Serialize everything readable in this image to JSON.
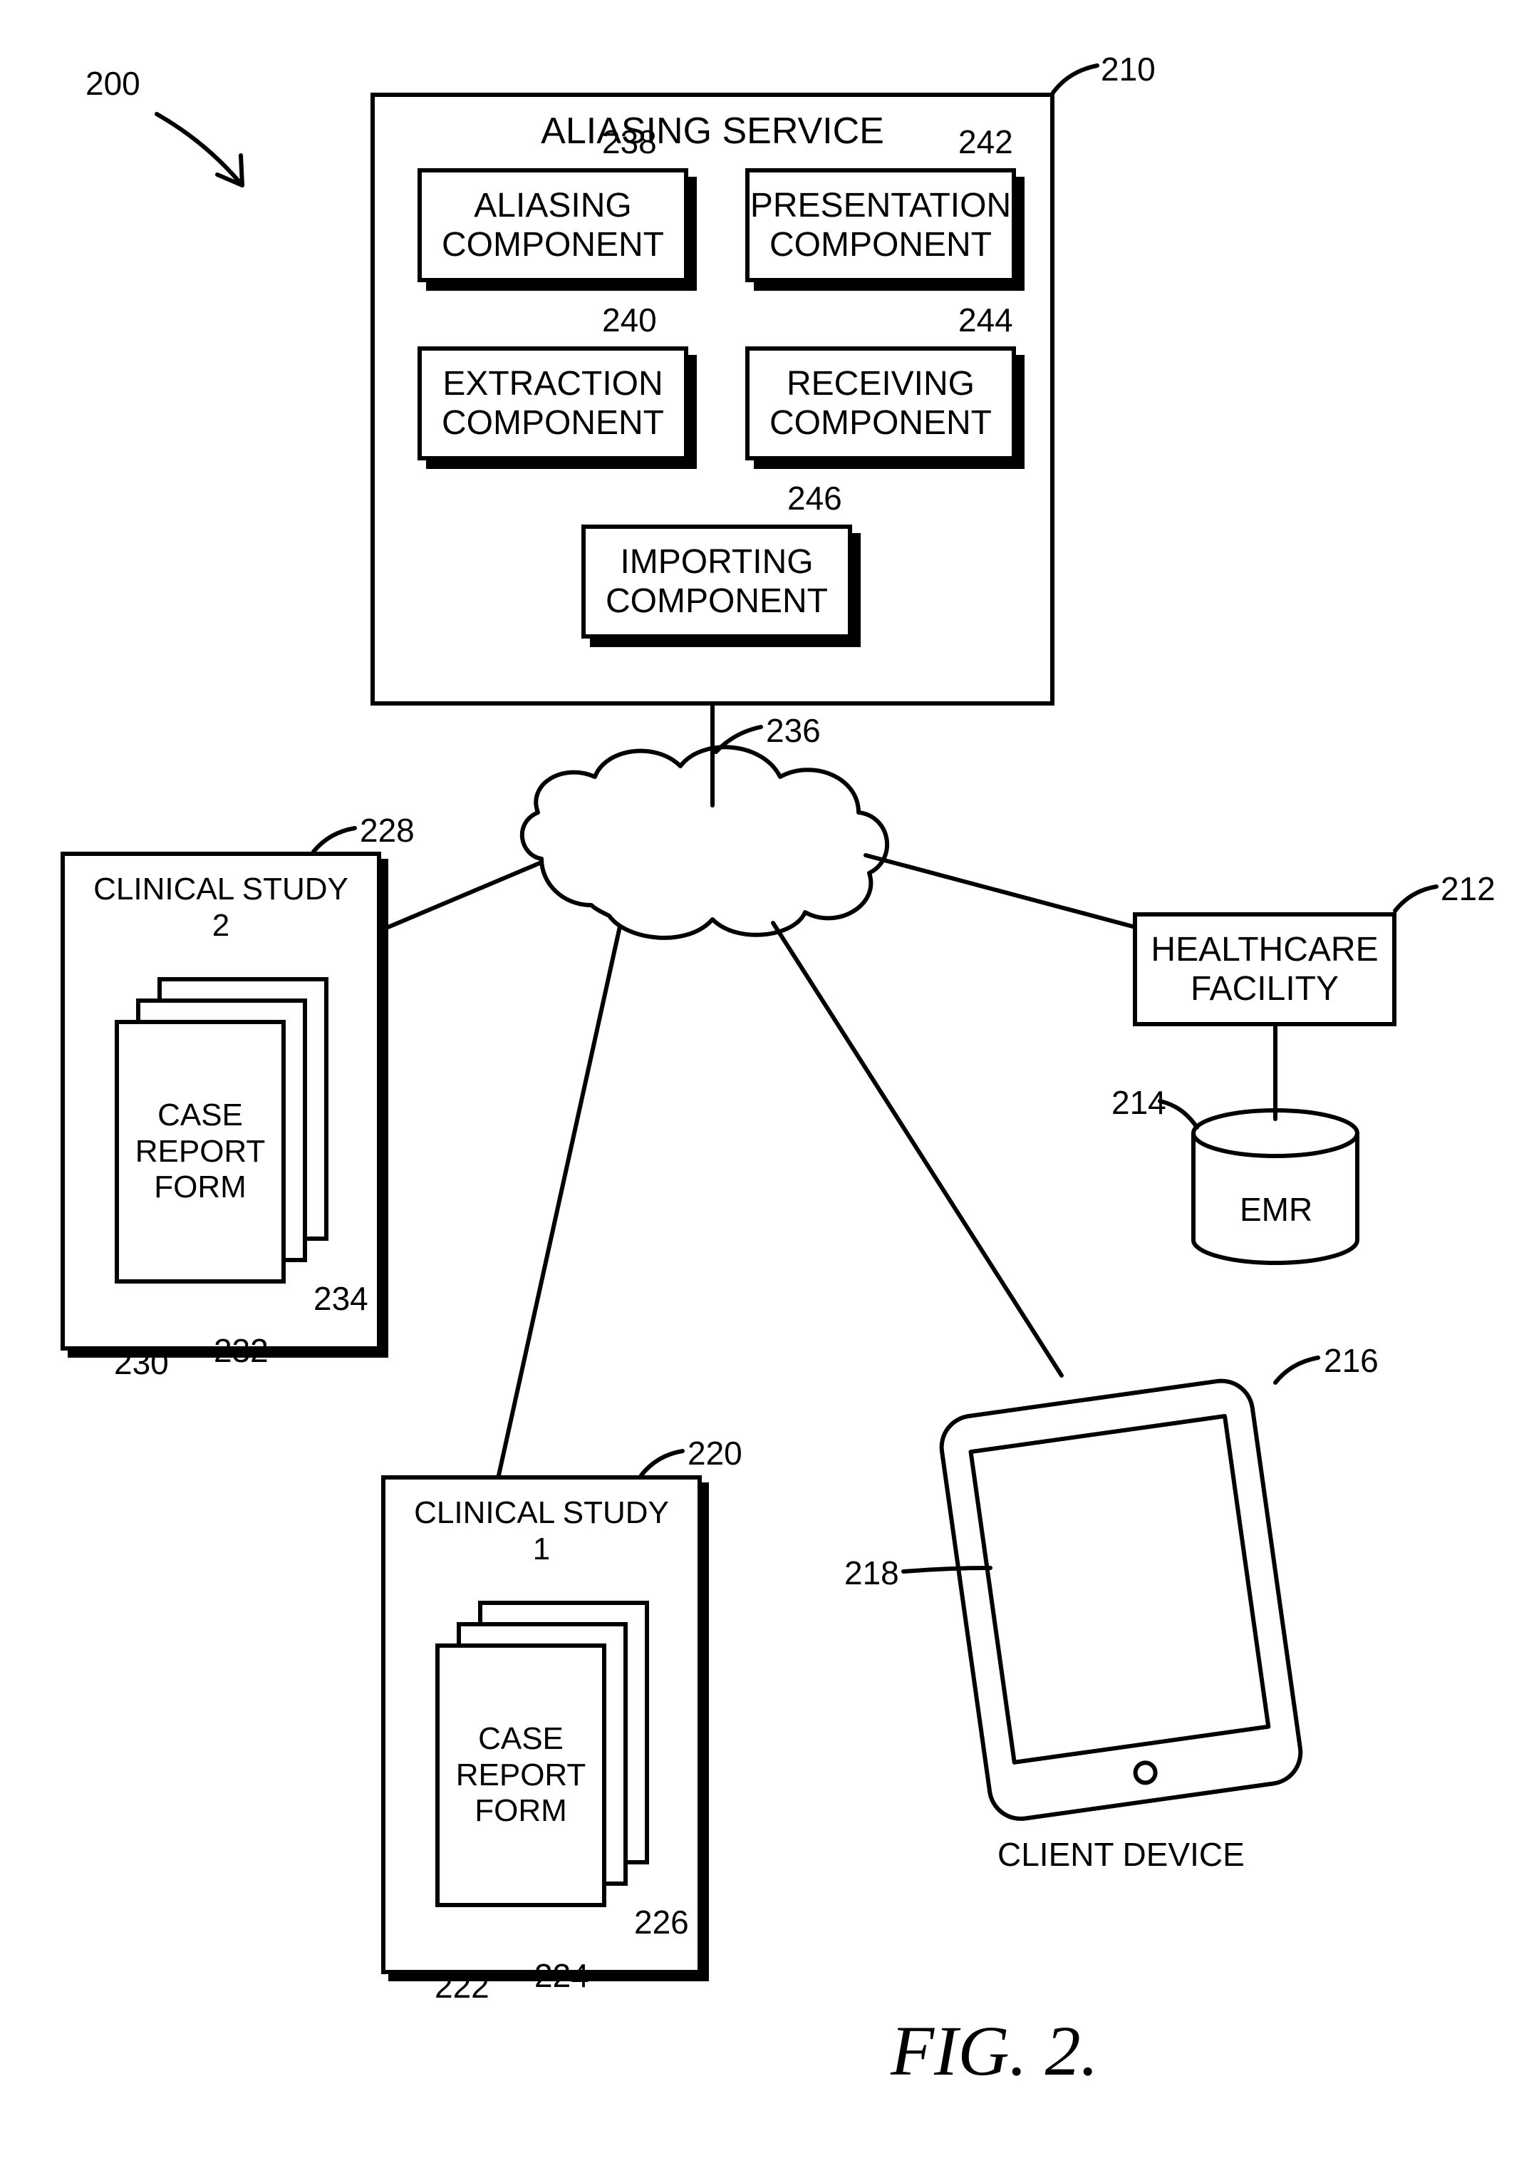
{
  "figure": {
    "number_ref": "200",
    "caption": "FIG. 2."
  },
  "aliasing_service": {
    "ref": "210",
    "title": "ALIASING SERVICE",
    "components": {
      "aliasing": {
        "ref": "238",
        "label": "ALIASING\nCOMPONENT"
      },
      "presentation": {
        "ref": "242",
        "label": "PRESENTATION\nCOMPONENT"
      },
      "extraction": {
        "ref": "240",
        "label": "EXTRACTION\nCOMPONENT"
      },
      "receiving": {
        "ref": "244",
        "label": "RECEIVING\nCOMPONENT"
      },
      "importing": {
        "ref": "246",
        "label": "IMPORTING\nCOMPONENT"
      }
    }
  },
  "cloud": {
    "ref": "236"
  },
  "clinical_study_2": {
    "ref": "228",
    "title": "CLINICAL STUDY\n2",
    "crf_label": "CASE\nREPORT\nFORM",
    "crf_refs": {
      "front": "230",
      "mid": "232",
      "back": "234"
    }
  },
  "clinical_study_1": {
    "ref": "220",
    "title": "CLINICAL STUDY\n1",
    "crf_label": "CASE\nREPORT\nFORM",
    "crf_refs": {
      "front": "222",
      "mid": "224",
      "back": "226"
    }
  },
  "healthcare_facility": {
    "ref": "212",
    "label": "HEALTHCARE\nFACILITY"
  },
  "emr": {
    "ref": "214",
    "label": "EMR"
  },
  "client_device": {
    "ref": "216",
    "screen_ref": "218",
    "label": "CLIENT DEVICE"
  }
}
